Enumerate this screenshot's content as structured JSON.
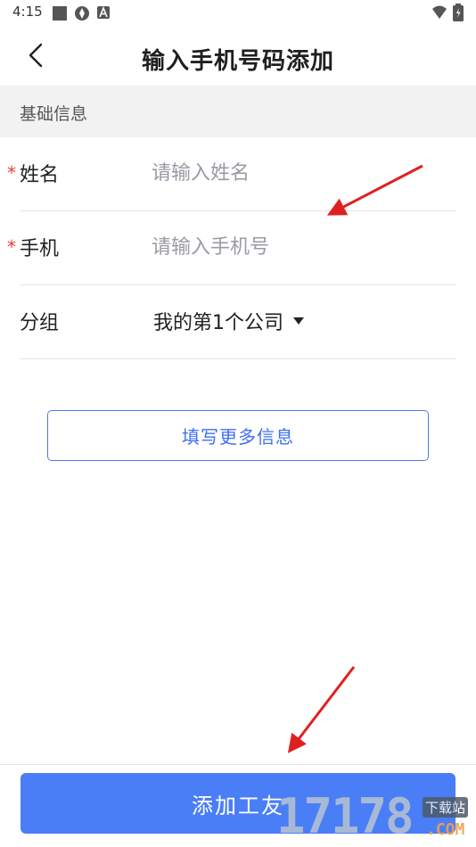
{
  "status_bar": {
    "time": "4:15",
    "left_icons": [
      "square-icon",
      "gear-sync-icon",
      "accessibility-icon"
    ],
    "right_icons": [
      "wifi-icon",
      "battery-icon"
    ]
  },
  "nav": {
    "title": "输入手机号码添加",
    "back_icon": "chevron-left-icon"
  },
  "section": {
    "title": "基础信息"
  },
  "form": {
    "name": {
      "label": "姓名",
      "required_mark": "*",
      "placeholder": "请输入姓名",
      "value": ""
    },
    "phone": {
      "label": "手机",
      "required_mark": "*",
      "placeholder": "请输入手机号",
      "value": ""
    },
    "group": {
      "label": "分组",
      "value": "我的第1个公司",
      "icon": "caret-down-icon"
    }
  },
  "more_info_button": {
    "label": "填写更多信息"
  },
  "add_button": {
    "label": "添加工友"
  },
  "watermark": {
    "number": "17178",
    "small": "下载站",
    "domain": ".COM"
  },
  "colors": {
    "primary": "#4a7ef6",
    "primary_text": "#3d6ff0",
    "required": "#e5403a",
    "section_bg": "#f2f2f2",
    "annotation_arrow": "#e02020"
  }
}
